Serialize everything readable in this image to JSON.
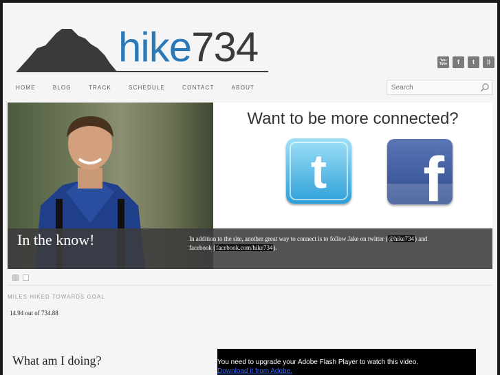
{
  "logo": {
    "word_a": "hike",
    "word_b": "734"
  },
  "social": [
    {
      "icon": "youtube-icon",
      "glyph": "You Tube"
    },
    {
      "icon": "facebook-icon",
      "glyph": "f"
    },
    {
      "icon": "twitter-icon",
      "glyph": "t"
    },
    {
      "icon": "rss-icon",
      "glyph": "))"
    }
  ],
  "nav": [
    "HOME",
    "BLOG",
    "TRACK",
    "SCHEDULE",
    "CONTACT",
    "ABOUT"
  ],
  "search": {
    "placeholder": "Search"
  },
  "slide": {
    "promo_title": "Want to be more connected?",
    "twitter_glyph": "t",
    "facebook_glyph": "f",
    "caption_title": "In the know!",
    "caption_pre": "In addition to the site, another great way to connect is to follow Jake on twitter (",
    "twitter_handle": "@hike734",
    "caption_mid": ") and facebook (",
    "facebook_url": "facebook.com/hike734",
    "caption_post": ")."
  },
  "miles": {
    "title": "MILES HIKED TOWARDS GOAL",
    "value": "14.94 out of 734.88"
  },
  "doing": {
    "title": "What am I doing?"
  },
  "flash": {
    "message": "You need to upgrade your Adobe Flash Player to watch this video.",
    "link": "Download it from Adobe."
  },
  "colors": {
    "brand_blue": "#2a78b8",
    "logo_dark": "#3a3a3a",
    "twitter_blue": "#2d9fd8",
    "facebook_blue": "#3b5998"
  }
}
